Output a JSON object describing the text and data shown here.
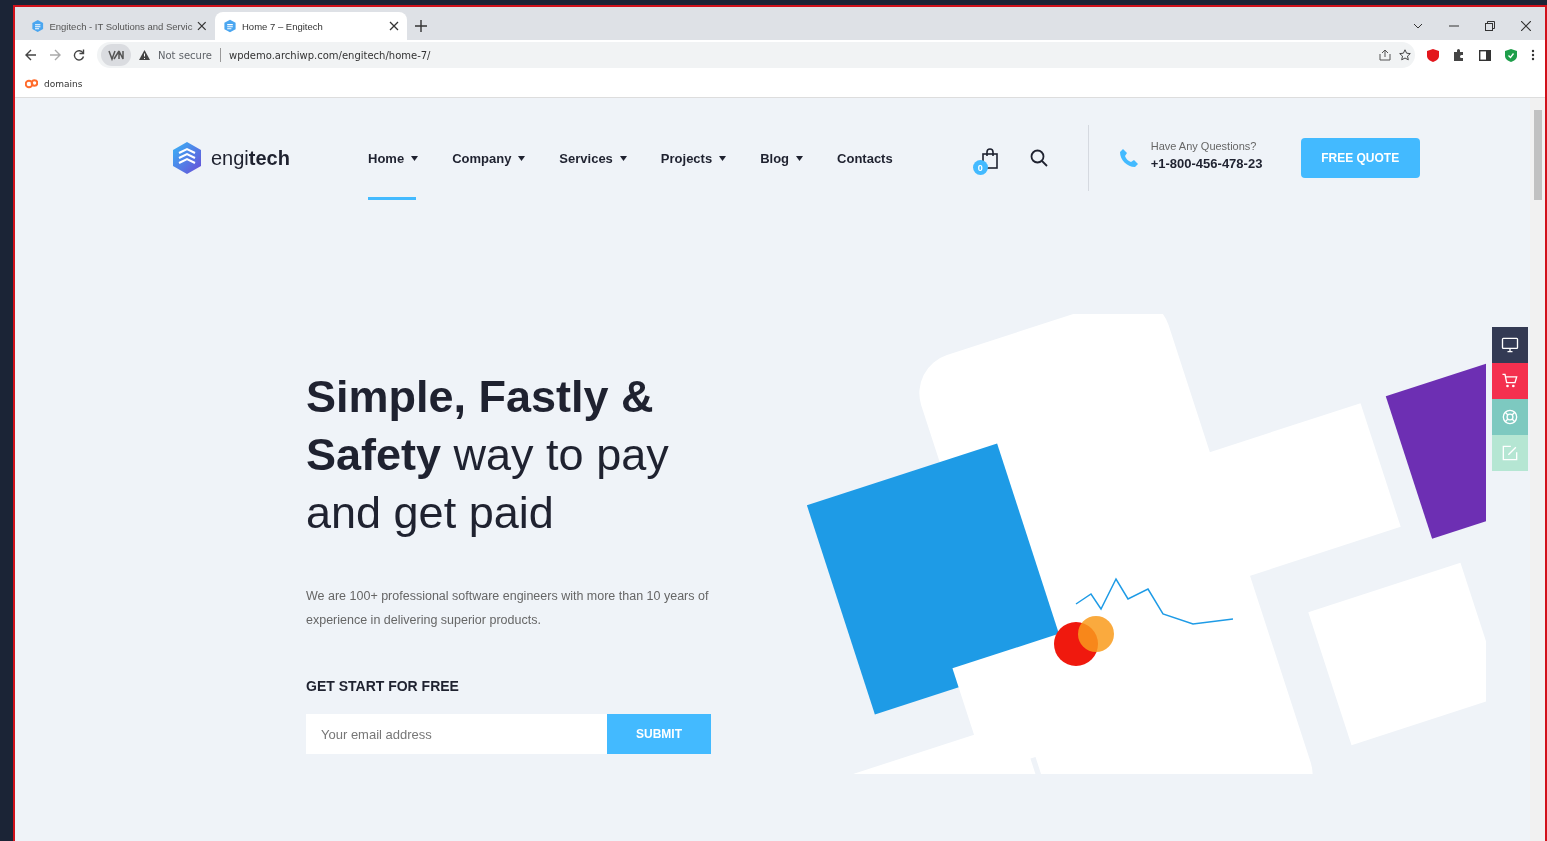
{
  "browser": {
    "tabs": [
      {
        "title": "Engitech - IT Solutions and Servic",
        "selected": false
      },
      {
        "title": "Home 7 – Engitech",
        "selected": true
      }
    ],
    "security_label": "Not secure",
    "url": "wpdemo.archiwp.com/engitech/home-7/",
    "bookmarks": [
      "domains"
    ]
  },
  "header": {
    "logo_light": "engi",
    "logo_bold": "tech",
    "nav": [
      {
        "label": "Home",
        "has_menu": true,
        "selected": true
      },
      {
        "label": "Company",
        "has_menu": true,
        "selected": false
      },
      {
        "label": "Services",
        "has_menu": true,
        "selected": false
      },
      {
        "label": "Projects",
        "has_menu": true,
        "selected": false
      },
      {
        "label": "Blog",
        "has_menu": true,
        "selected": false
      },
      {
        "label": "Contacts",
        "has_menu": false,
        "selected": false
      }
    ],
    "cart_count": "0",
    "contact_label": "Have Any Questions?",
    "phone": "+1-800-456-478-23",
    "quote_button": "FREE QUOTE"
  },
  "hero": {
    "title": "**Simple, Fastly & Safety** way to pay and get paid",
    "description": "We are 100+ professional software engineers with more than 10 years of experience in delivering superior products.",
    "signup_heading": "GET START FOR FREE",
    "email": {
      "placeholder": "Your email address"
    },
    "submit": "SUBMIT"
  },
  "side_tools": [
    {
      "kind": "monitor",
      "color": "#333a54"
    },
    {
      "kind": "cart",
      "color": "#f4304f"
    },
    {
      "kind": "lifebuoy",
      "color": "#7dc9c0"
    },
    {
      "kind": "edit",
      "color": "#b5e6d3"
    }
  ]
}
